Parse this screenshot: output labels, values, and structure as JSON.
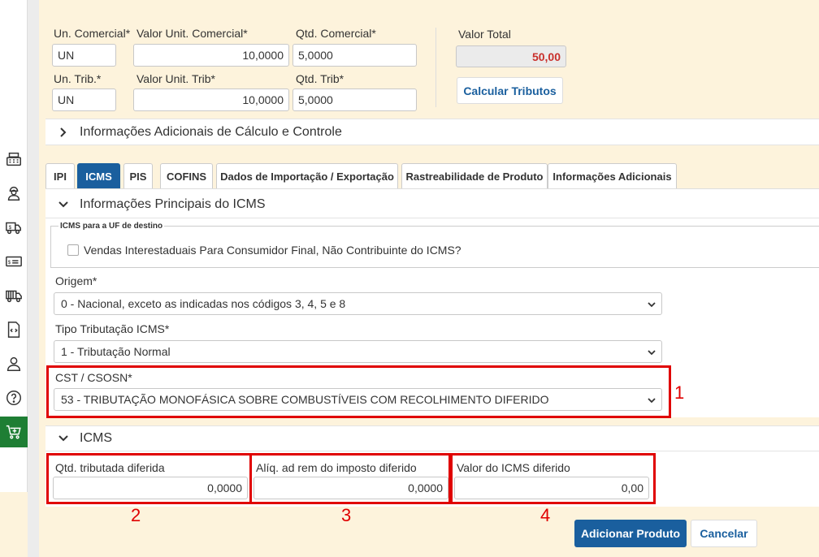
{
  "commercial": {
    "un_label": "Un. Comercial*",
    "un_value": "UN",
    "valor_unit_label": "Valor Unit. Comercial*",
    "valor_unit_value": "10,0000",
    "qtd_label": "Qtd. Comercial*",
    "qtd_value": "5,0000"
  },
  "trib": {
    "un_label": "Un. Trib.*",
    "un_value": "UN",
    "valor_unit_label": "Valor Unit. Trib*",
    "valor_unit_value": "10,0000",
    "qtd_label": "Qtd. Trib*",
    "qtd_value": "5,0000"
  },
  "total": {
    "label": "Valor Total",
    "value": "50,00",
    "calc_button": "Calcular Tributos"
  },
  "additional_section": "Informações Adicionais de Cálculo e Controle",
  "tabs": [
    "IPI",
    "ICMS",
    "PIS",
    "COFINS",
    "Dados de Importação / Exportação",
    "Rastreabilidade de Produto",
    "Informações Adicionais"
  ],
  "active_tab": "ICMS",
  "icms_principal": {
    "title": "Informações Principais do ICMS",
    "fieldset_legend": "ICMS para a UF de destino",
    "checkbox_label": "Vendas Interestaduais Para Consumidor Final, Não Contribuinte do ICMS?",
    "origem_label": "Origem*",
    "origem_value": "0 - Nacional, exceto as indicadas nos códigos 3, 4, 5 e 8",
    "tipo_label": "Tipo Tributação ICMS*",
    "tipo_value": "1 - Tributação Normal",
    "cst_label": "CST / CSOSN*",
    "cst_value": "53 - TRIBUTAÇÃO MONOFÁSICA SOBRE COMBUSTÍVEIS COM RECOLHIMENTO DIFERIDO"
  },
  "icms_section": {
    "title": "ICMS",
    "qtd_label": "Qtd. tributada diferida",
    "qtd_value": "0,0000",
    "aliq_label": "Alíq. ad rem do imposto diferido",
    "aliq_value": "0,0000",
    "valor_label": "Valor do ICMS diferido",
    "valor_value": "0,00"
  },
  "annotations": [
    "1",
    "2",
    "3",
    "4"
  ],
  "footer": {
    "add_button": "Adicionar Produto",
    "cancel_button": "Cancelar"
  },
  "colors": {
    "primary": "#1a5f9e",
    "highlight": "#e00000",
    "total": "#c9302c",
    "background": "#fdf3dc",
    "sidebar_active": "#1e7e34"
  },
  "sidebar_icons": [
    "cash-register-icon",
    "user-worker-icon",
    "truck-money-icon",
    "money-bill-icon",
    "truck-icon",
    "code-file-icon",
    "user-icon",
    "help-icon",
    "cart-add-icon"
  ]
}
